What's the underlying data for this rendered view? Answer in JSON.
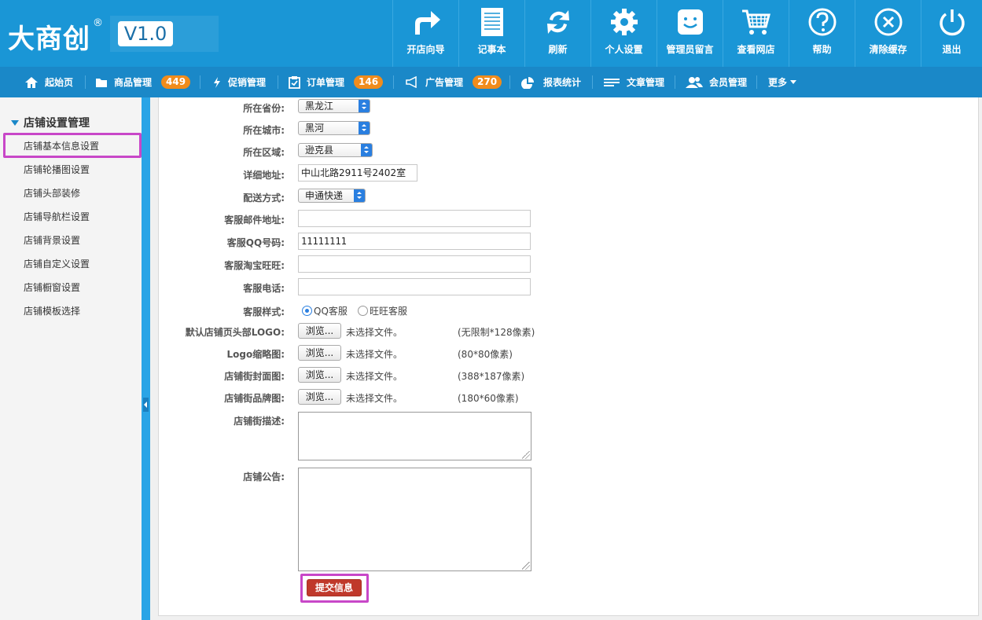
{
  "logo": {
    "brand": "大商创",
    "reg": "®",
    "version": "V1.0"
  },
  "toolbar": [
    {
      "label": "开店向导",
      "icon": "redo-arrow-icon"
    },
    {
      "label": "记事本",
      "icon": "notepad-icon"
    },
    {
      "label": "刷新",
      "icon": "refresh-icon"
    },
    {
      "label": "个人设置",
      "icon": "gear-icon"
    },
    {
      "label": "管理员留言",
      "icon": "smiley-message-icon"
    },
    {
      "label": "查看网店",
      "icon": "shopping-cart-icon"
    },
    {
      "label": "帮助",
      "icon": "help-icon"
    },
    {
      "label": "清除缓存",
      "icon": "close-circle-icon"
    },
    {
      "label": "退出",
      "icon": "power-icon"
    }
  ],
  "nav": [
    {
      "label": "起始页",
      "icon": "home-icon"
    },
    {
      "label": "商品管理",
      "icon": "folder-icon",
      "badge": "449"
    },
    {
      "label": "促销管理",
      "icon": "lightning-icon"
    },
    {
      "label": "订单管理",
      "icon": "clipboard-icon",
      "badge": "146"
    },
    {
      "label": "广告管理",
      "icon": "megaphone-icon",
      "badge": "270"
    },
    {
      "label": "报表统计",
      "icon": "pie-chart-icon"
    },
    {
      "label": "文章管理",
      "icon": "lines-icon"
    },
    {
      "label": "会员管理",
      "icon": "users-icon"
    },
    {
      "label": "更多",
      "icon": "caret-down-icon"
    }
  ],
  "sidebar": {
    "group_title": "店铺设置管理",
    "items": [
      "店铺基本信息设置",
      "店铺轮播图设置",
      "店铺头部装修",
      "店铺导航栏设置",
      "店铺背景设置",
      "店铺自定义设置",
      "店铺橱窗设置",
      "店铺模板选择"
    ]
  },
  "form": {
    "province": {
      "label": "所在省份:",
      "value": "黑龙江"
    },
    "city": {
      "label": "所在城市:",
      "value": "黑河"
    },
    "district": {
      "label": "所在区域:",
      "value": "逊克县"
    },
    "address": {
      "label": "详细地址:",
      "value": "中山北路2911号2402室"
    },
    "shipping": {
      "label": "配送方式:",
      "value": "申通快递"
    },
    "cs_email": {
      "label": "客服邮件地址:",
      "value": ""
    },
    "cs_qq": {
      "label": "客服QQ号码:",
      "value": "11111111"
    },
    "cs_wangwang": {
      "label": "客服淘宝旺旺:",
      "value": ""
    },
    "cs_phone": {
      "label": "客服电话:",
      "value": ""
    },
    "cs_style": {
      "label": "客服样式:",
      "option_qq": "QQ客服",
      "option_ww": "旺旺客服"
    },
    "browse_label": "浏览...",
    "no_file": "未选择文件。",
    "logo_header": {
      "label": "默认店铺页头部LOGO:",
      "hint": "(无限制*128像素)"
    },
    "logo_thumb": {
      "label": "Logo缩略图:",
      "hint": "(80*80像素)"
    },
    "street_cover": {
      "label": "店铺街封面图:",
      "hint": "(388*187像素)"
    },
    "street_brand": {
      "label": "店铺街品牌图:",
      "hint": "(180*60像素)"
    },
    "street_desc": {
      "label": "店铺街描述:"
    },
    "notice": {
      "label": "店铺公告:"
    },
    "submit": "提交信息"
  },
  "colors": {
    "header_bg": "#1a96d6",
    "nav_bg": "#1a88c8",
    "badge": "#f08c1c",
    "submit": "#c0392b",
    "highlight": "#c847c8"
  }
}
